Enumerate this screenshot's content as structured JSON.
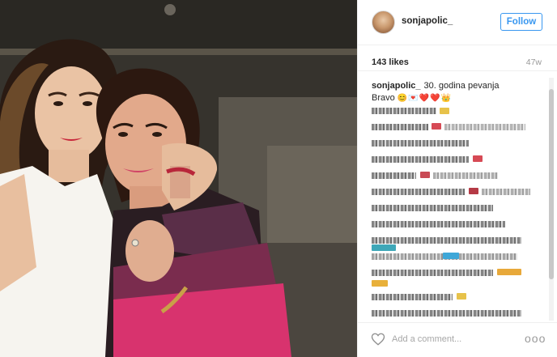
{
  "post": {
    "username": "sonjapolic_",
    "follow_label": "Follow",
    "likes": "143 likes",
    "age": "47w",
    "caption_user": "sonjapolic_",
    "caption_text": "30. godina pevanja",
    "caption_line2": "Bravo",
    "caption_emojis": "😊💌❤️❤️👑",
    "comment_placeholder": "Add a comment...",
    "more_label": "ooo"
  },
  "icons": {
    "heart": "heart-icon",
    "more": "more-icon"
  },
  "colors": {
    "accent": "#3897f0",
    "text": "#262626",
    "muted": "#999999",
    "divider": "#efefef"
  }
}
